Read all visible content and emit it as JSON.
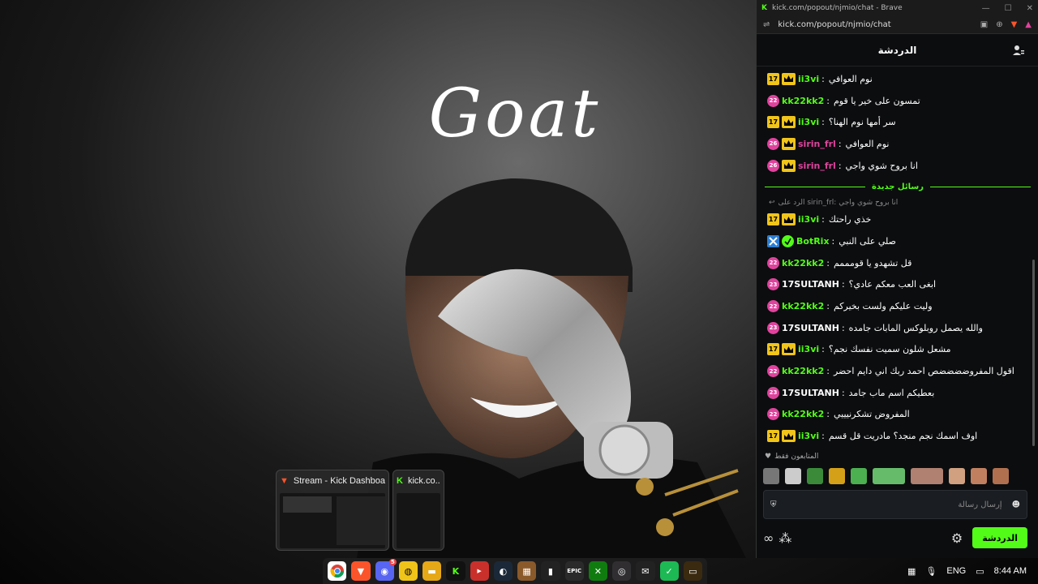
{
  "wallpaper": {
    "title_text": "Goat"
  },
  "browser": {
    "window_title": "kick.com/popout/njmio/chat - Brave",
    "address": "kick.com/popout/njmio/chat"
  },
  "chat": {
    "header": "الدردشة",
    "new_messages_label": "رسائل جديدة",
    "reply_to": "الرد على sirin_frl: انا بروح شوي واجي",
    "followers_only": "المتابعون فقط",
    "input_placeholder": "إرسال رسالة",
    "chat_button": "الدردشة",
    "colors": {
      "accent": "#53fc18",
      "gold": "#f0c419",
      "pink": "#e0439d"
    },
    "messages_before": [
      {
        "badge": "17",
        "badge_type": "sub",
        "crown": true,
        "user": "ii3vi",
        "user_color": "#53fc18",
        "text": "نوم العوافي"
      },
      {
        "badge": "22",
        "badge_type": "tri",
        "crown": false,
        "user": "kk22kk2",
        "user_color": "#53fc18",
        "text": "تمسون على خير يا قوم"
      },
      {
        "badge": "17",
        "badge_type": "sub",
        "crown": true,
        "user": "ii3vi",
        "user_color": "#53fc18",
        "text": "سر أمها نوم الهنا؟"
      },
      {
        "badge": "26",
        "badge_type": "tri",
        "crown": true,
        "user": "sirin_frl",
        "user_color": "#e0439d",
        "text": "نوم العوافي"
      },
      {
        "badge": "26",
        "badge_type": "tri",
        "crown": true,
        "user": "sirin_frl",
        "user_color": "#e0439d",
        "text": "انا بروح شوي واجي"
      }
    ],
    "messages_after": [
      {
        "badge": "17",
        "badge_type": "sub",
        "crown": true,
        "user": "ii3vi",
        "user_color": "#53fc18",
        "text": "خذي راحتك"
      },
      {
        "badge": "",
        "badge_type": "bot",
        "crown": false,
        "user": "BotRix",
        "user_color": "#53fc18",
        "text": "صلي على النبي"
      },
      {
        "badge": "22",
        "badge_type": "tri",
        "crown": false,
        "user": "kk22kk2",
        "user_color": "#53fc18",
        "text": "قل تشهدو يا قومممم"
      },
      {
        "badge": "23",
        "badge_type": "tri",
        "crown": false,
        "user": "17SULTANH",
        "user_color": "#ffffff",
        "text": "ابغى العب معكم عادي؟"
      },
      {
        "badge": "22",
        "badge_type": "tri",
        "crown": false,
        "user": "kk22kk2",
        "user_color": "#53fc18",
        "text": "وليت عليكم ولست بخيركم"
      },
      {
        "badge": "23",
        "badge_type": "tri",
        "crown": false,
        "user": "17SULTANH",
        "user_color": "#ffffff",
        "text": "والله يصمل روبلوكس المابات جامده"
      },
      {
        "badge": "17",
        "badge_type": "sub",
        "crown": true,
        "user": "ii3vi",
        "user_color": "#53fc18",
        "text": "مشعل شلون سميت نفسك نجم؟"
      },
      {
        "badge": "22",
        "badge_type": "tri",
        "crown": false,
        "user": "kk22kk2",
        "user_color": "#53fc18",
        "text": "اقول المفروضضضضص احمد ربك اني دايم احضر"
      },
      {
        "badge": "23",
        "badge_type": "tri",
        "crown": false,
        "user": "17SULTANH",
        "user_color": "#ffffff",
        "text": "بعطيكم اسم ماب جامد"
      },
      {
        "badge": "22",
        "badge_type": "tri",
        "crown": false,
        "user": "kk22kk2",
        "user_color": "#53fc18",
        "text": "المفروض تشكرنيييي"
      },
      {
        "badge": "17",
        "badge_type": "sub",
        "crown": true,
        "user": "ii3vi",
        "user_color": "#53fc18",
        "text": "اوف اسمك نجم منجد؟ مادريت قل قسم"
      }
    ]
  },
  "thumbnails": [
    {
      "title": "Stream - Kick Dashboard..."
    },
    {
      "title": "kick.co..."
    }
  ],
  "taskbar": {
    "apps": [
      "chrome-icon",
      "brave-icon",
      "discord-icon",
      "folder-icon",
      "file-explorer-icon",
      "kick-icon",
      "capcut-icon",
      "steam-icon",
      "game-icon",
      "terminal-icon",
      "epic-icon",
      "xbox-icon",
      "obs-icon",
      "mail-icon",
      "app-green-icon",
      "app-dark-icon"
    ],
    "discord_badge": "5",
    "epic_label": "EPIC",
    "language": "ENG",
    "time": "8:44 AM"
  }
}
